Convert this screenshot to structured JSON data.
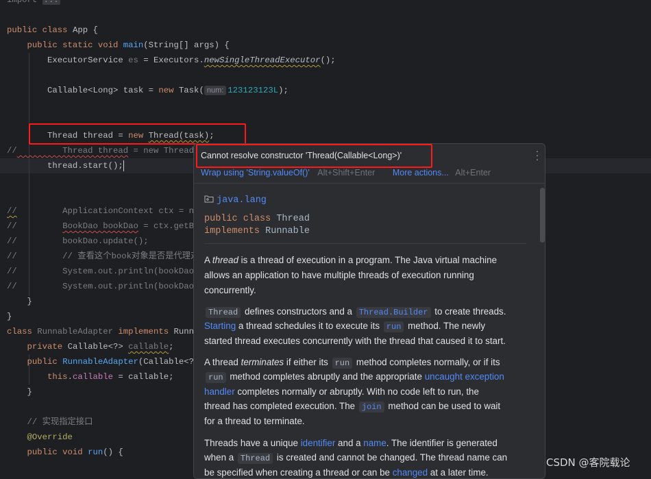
{
  "colors": {
    "background": "#1e1f22",
    "keyword": "#cf8e6d",
    "method": "#56a8f5",
    "number": "#2aacb8",
    "comment": "#7a7e85",
    "link": "#548af7",
    "highlight_box": "#ff1a1a"
  },
  "editor": {
    "current_line": 11,
    "lines": [
      [
        [
          "import ",
          "dim"
        ],
        [
          "...",
          "fold"
        ]
      ],
      [],
      [
        [
          "public class ",
          "kw"
        ],
        [
          "App {",
          ""
        ]
      ],
      [
        [
          "    public static void ",
          "kw"
        ],
        [
          "main",
          "fn"
        ],
        [
          "(String[] args) {",
          ""
        ]
      ],
      [
        [
          "        ExecutorService ",
          ""
        ],
        [
          "es",
          "dim"
        ],
        [
          " = Executors.",
          ""
        ],
        [
          "newSingleThreadExecutor",
          "it warn"
        ],
        [
          "();",
          ""
        ]
      ],
      [],
      [
        [
          "        Callable<Long> task = ",
          ""
        ],
        [
          "new ",
          "kw"
        ],
        [
          "Task(",
          ""
        ],
        [
          "num:",
          "hint"
        ],
        [
          "123123123L",
          "num"
        ],
        [
          ");",
          ""
        ]
      ],
      [],
      [],
      [
        [
          "        Thread thread = ",
          ""
        ],
        [
          "new ",
          "kw"
        ],
        [
          "Thread(task)",
          "warn"
        ],
        [
          ";",
          ""
        ]
      ],
      [
        [
          "//",
          "cm"
        ],
        [
          "         Thread thread",
          "cm err"
        ],
        [
          " = new Thread(new RunnableAdapter(task));",
          "cm"
        ]
      ],
      [
        [
          "        thread.start();",
          ""
        ],
        [
          "",
          "caret"
        ]
      ],
      [],
      [],
      [
        [
          "//",
          "cm warn"
        ],
        [
          "         ApplicationContext ctx = new ClassPathXmlApplicationContext(\"applicationContext.xml\");",
          "cm"
        ]
      ],
      [
        [
          "//         ",
          "cm"
        ],
        [
          "BookDao bookDao",
          "cm err"
        ],
        [
          " = ctx.getBean(BookDao.class);",
          "cm"
        ]
      ],
      [
        [
          "//         bookDao.update();",
          "cm"
        ]
      ],
      [
        [
          "//         // 查看这个book对象是否是代理对象",
          "cm"
        ]
      ],
      [
        [
          "//         System.out.println(bookDao);",
          "cm"
        ]
      ],
      [
        [
          "//         System.out.println(bookDao.getClass());",
          "cm"
        ]
      ],
      [
        [
          "    }",
          ""
        ]
      ],
      [
        [
          "}",
          ""
        ]
      ],
      [
        [
          "class ",
          "kw"
        ],
        [
          "RunnableAdapter ",
          "dim"
        ],
        [
          "implements ",
          "kw"
        ],
        [
          "Runnable {",
          ""
        ]
      ],
      [
        [
          "    private ",
          "kw"
        ],
        [
          "Callable<?> ",
          ""
        ],
        [
          "callable",
          "dim warn"
        ],
        [
          ";",
          ""
        ]
      ],
      [
        [
          "    public ",
          "kw"
        ],
        [
          "RunnableAdapter",
          "fn"
        ],
        [
          "(Callable<?> callable) {",
          ""
        ]
      ],
      [
        [
          "        this",
          "kw"
        ],
        [
          ".",
          ""
        ],
        [
          "callable",
          "fd"
        ],
        [
          " = callable;",
          ""
        ]
      ],
      [
        [
          "    }",
          ""
        ]
      ],
      [],
      [
        [
          "    // 实现指定接口",
          "cm"
        ]
      ],
      [
        [
          "    @Override",
          "an"
        ]
      ],
      [
        [
          "    public void ",
          "kw"
        ],
        [
          "run",
          "fn"
        ],
        [
          "() {",
          ""
        ]
      ]
    ]
  },
  "popup": {
    "error_message": "Cannot resolve constructor 'Thread(Callable<Long>)'",
    "menu_icon": "more-vertical-icon",
    "action1_label": "Wrap using 'String.valueOf()'",
    "action1_shortcut": "Alt+Shift+Enter",
    "action2_label": "More actions...",
    "action2_shortcut": "Alt+Enter",
    "doc": {
      "package_icon": "package-folder-icon",
      "package": "java.lang",
      "decl_kw1": "public class ",
      "decl_name": "Thread",
      "decl_kw2": "implements ",
      "decl_iface": "Runnable",
      "lines": [
        [
          [
            "A ",
            "t"
          ],
          [
            "thread",
            "i"
          ],
          [
            " is a thread of execution in a program. The Java virtual machine",
            "t"
          ]
        ],
        [
          [
            "allows an application to have multiple threads of execution running",
            "t"
          ]
        ],
        [
          [
            "concurrently.",
            "t"
          ]
        ],
        [
          [
            "Thread",
            "c"
          ],
          [
            " defines constructors and a ",
            "t"
          ],
          [
            "Thread.Builder",
            "cl"
          ],
          [
            " to create threads.",
            "t"
          ]
        ],
        [
          [
            "Starting",
            "l"
          ],
          [
            " a thread schedules it to execute its ",
            "t"
          ],
          [
            "run",
            "cl"
          ],
          [
            " method. The newly",
            "t"
          ]
        ],
        [
          [
            "started thread executes concurrently with the thread that caused it to start.",
            "t"
          ]
        ],
        [
          [
            "A thread ",
            "t"
          ],
          [
            "terminates",
            "i"
          ],
          [
            " if either its ",
            "t"
          ],
          [
            "run",
            "c"
          ],
          [
            " method completes normally, or if its",
            "t"
          ]
        ],
        [
          [
            "run",
            "c"
          ],
          [
            " method completes abruptly and the appropriate ",
            "t"
          ],
          [
            "uncaught exception",
            "l"
          ]
        ],
        [
          [
            "handler",
            "l"
          ],
          [
            " completes normally or abruptly. With no code left to run, the",
            "t"
          ]
        ],
        [
          [
            "thread has completed execution. The ",
            "t"
          ],
          [
            "join",
            "cl"
          ],
          [
            " method can be used to wait",
            "t"
          ]
        ],
        [
          [
            "for a thread to terminate.",
            "t"
          ]
        ],
        [
          [
            "Threads have a unique ",
            "t"
          ],
          [
            "identifier",
            "l"
          ],
          [
            " and a ",
            "t"
          ],
          [
            "name",
            "l"
          ],
          [
            ". The identifier is generated",
            "t"
          ]
        ],
        [
          [
            "when a ",
            "t"
          ],
          [
            "Thread",
            "c"
          ],
          [
            " is created and cannot be changed. The thread name can",
            "t"
          ]
        ],
        [
          [
            "be specified when creating a thread or can be ",
            "t"
          ],
          [
            "changed",
            "l"
          ],
          [
            " at a later time.",
            "t"
          ]
        ]
      ]
    }
  },
  "watermark": "CSDN @客院载论"
}
